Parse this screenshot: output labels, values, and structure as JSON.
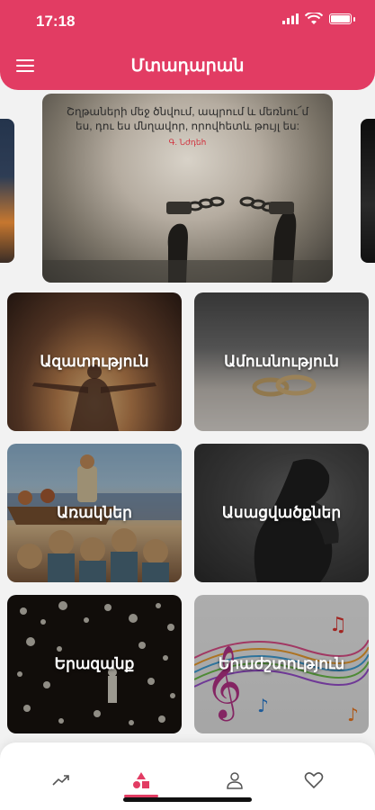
{
  "status_bar": {
    "time": "17:18"
  },
  "header": {
    "title": "Մտադարան"
  },
  "carousel": {
    "quote": "Շղթաների մեջ ծնվում, ապրում և մեռնու՜մ ես, դու ես մնղավոր, որովհետև թույլ ես:",
    "author": "Գ. Նժդեհ"
  },
  "categories": [
    {
      "label": "Ազատություն"
    },
    {
      "label": "Ամուսնություն"
    },
    {
      "label": "Առակներ"
    },
    {
      "label": "Ասացվածքներ"
    },
    {
      "label": "Երազանք"
    },
    {
      "label": "Երաժշտություն"
    }
  ],
  "bottom_nav": {
    "items": [
      {
        "icon": "trending-icon"
      },
      {
        "icon": "categories-icon",
        "active": true
      },
      {
        "icon": "user-icon"
      },
      {
        "icon": "heart-icon"
      }
    ]
  },
  "colors": {
    "accent": "#e23c63"
  }
}
